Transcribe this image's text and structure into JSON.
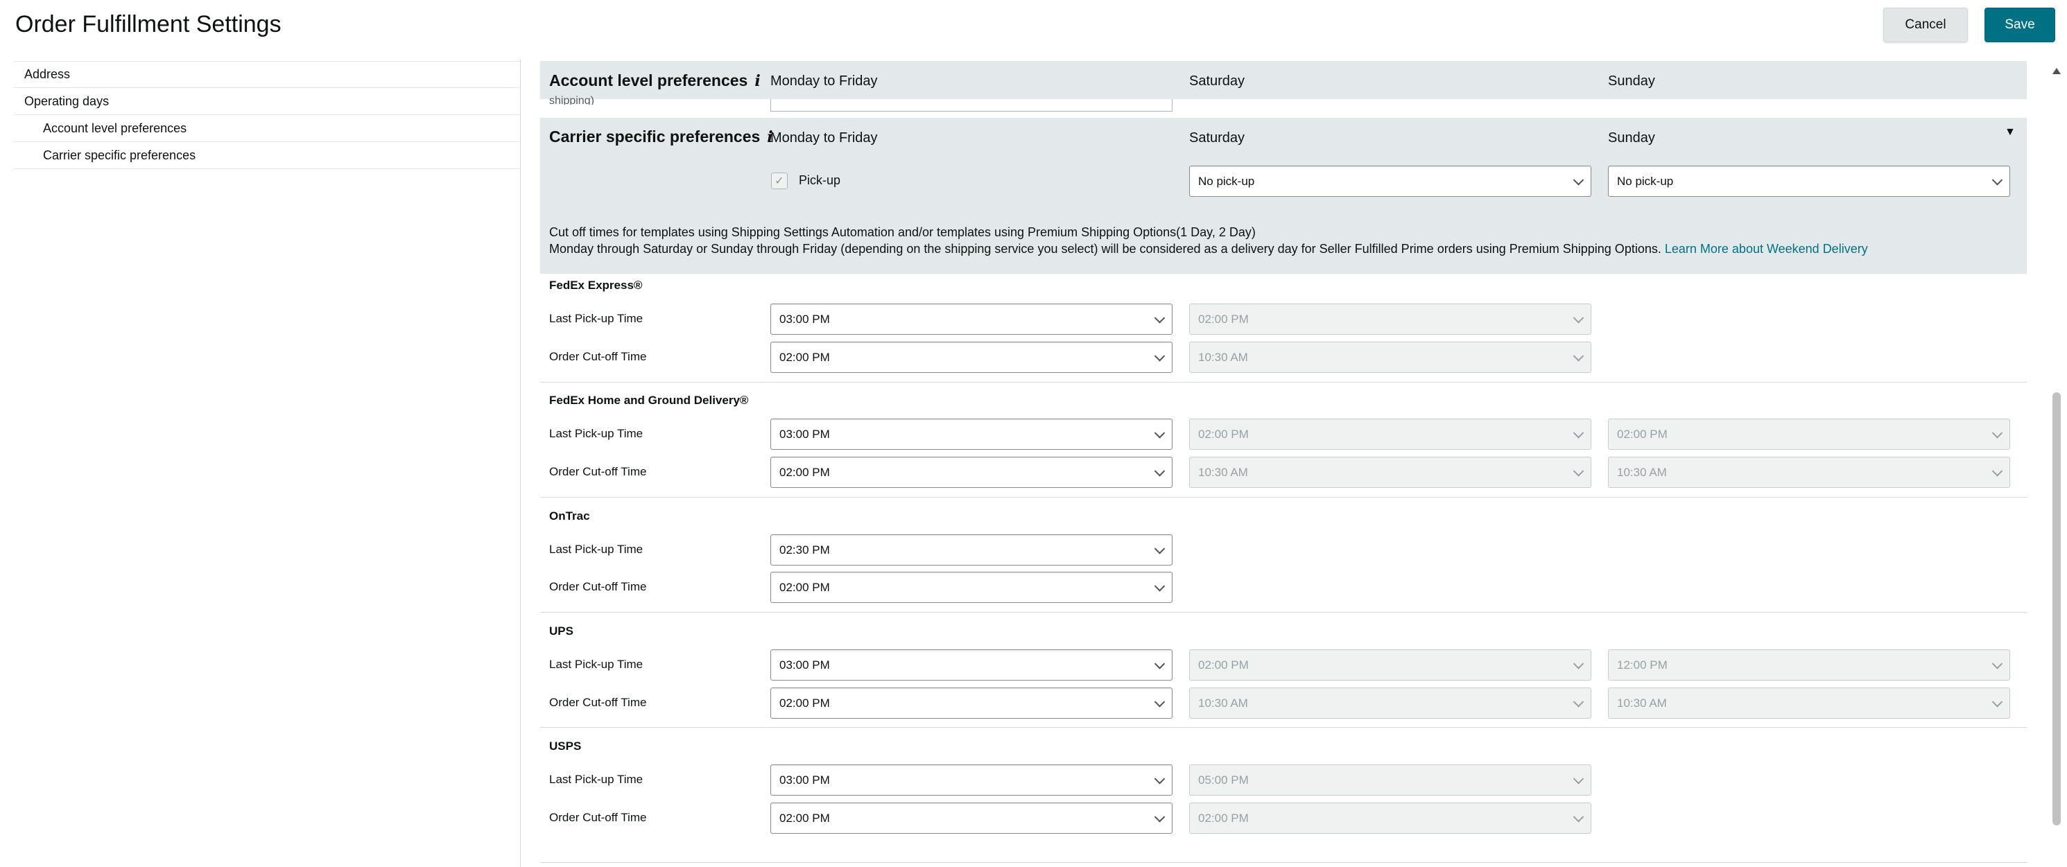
{
  "header": {
    "title": "Order Fulfillment Settings",
    "cancel_label": "Cancel",
    "save_label": "Save"
  },
  "sidebar": {
    "items": [
      {
        "label": "Address"
      },
      {
        "label": "Operating days"
      },
      {
        "label": "Account level preferences"
      },
      {
        "label": "Carrier specific preferences"
      }
    ]
  },
  "account_prefs": {
    "title": "Account level preferences",
    "info_icon": "i",
    "columns": [
      "Monday to Friday",
      "Saturday",
      "Sunday"
    ],
    "clipped_text": "shipping)"
  },
  "carrier_prefs": {
    "title": "Carrier specific preferences",
    "info_icon": "i",
    "columns": [
      "Monday to Friday",
      "Saturday",
      "Sunday"
    ],
    "collapse_icon": "▼",
    "pickup_label": "Pick-up",
    "pickup_checked": true,
    "saturday_value": "No pick-up",
    "sunday_value": "No pick-up"
  },
  "intro": {
    "line1": "Cut off times for templates using Shipping Settings Automation and/or templates using Premium Shipping Options(1 Day, 2 Day)",
    "line2": "Monday through Saturday or Sunday through Friday (depending on the shipping service you select) will be considered as a delivery day for Seller Fulfilled Prime orders using Premium Shipping Options.",
    "link": "Learn More about Weekend Delivery"
  },
  "row_labels": {
    "pickup": "Last Pick-up Time",
    "cutoff": "Order Cut-off Time"
  },
  "carriers": [
    {
      "name": "FedEx Express®",
      "pickup": [
        "03:00 PM",
        "02:00 PM"
      ],
      "cutoff": [
        "02:00 PM",
        "10:30 AM"
      ]
    },
    {
      "name": "FedEx Home and Ground Delivery®",
      "pickup": [
        "03:00 PM",
        "02:00 PM",
        "02:00 PM"
      ],
      "cutoff": [
        "02:00 PM",
        "10:30 AM",
        "10:30 AM"
      ]
    },
    {
      "name": "OnTrac",
      "pickup": [
        "02:30 PM"
      ],
      "cutoff": [
        "02:00 PM"
      ]
    },
    {
      "name": "UPS",
      "pickup": [
        "03:00 PM",
        "02:00 PM",
        "12:00 PM"
      ],
      "cutoff": [
        "02:00 PM",
        "10:30 AM",
        "10:30 AM"
      ]
    },
    {
      "name": "USPS",
      "pickup": [
        "03:00 PM",
        "05:00 PM"
      ],
      "cutoff": [
        "02:00 PM",
        "02:00 PM"
      ]
    }
  ]
}
